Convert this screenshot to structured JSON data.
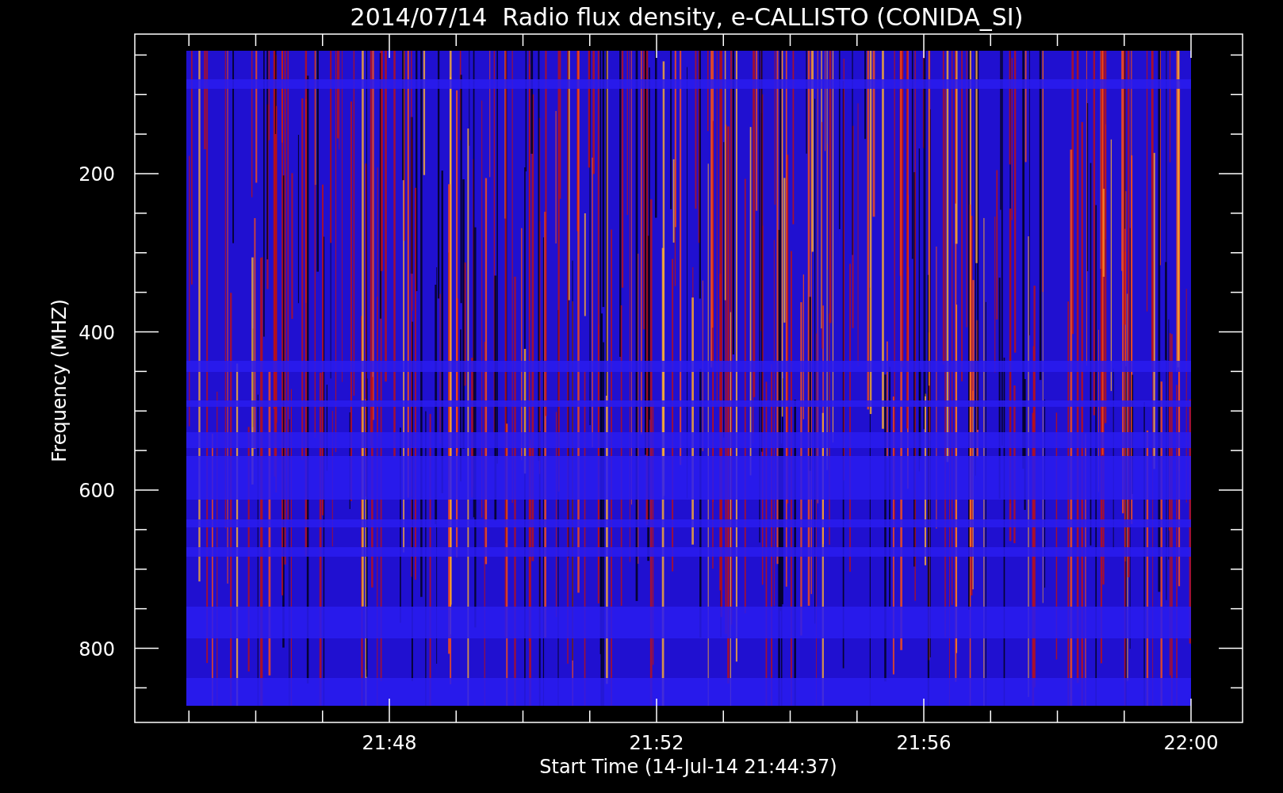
{
  "chart": {
    "title": "2014/07/14  Radio flux density, e-CALLISTO (CONIDA_SI)",
    "ylabel": "Frequency (MHZ)",
    "xlabel": "Start Time (14-Jul-14 21:44:37)",
    "yticks": [
      "200",
      "400",
      "600",
      "800"
    ],
    "xticks": [
      "21:48",
      "21:52",
      "21:56",
      "22:00"
    ]
  }
}
